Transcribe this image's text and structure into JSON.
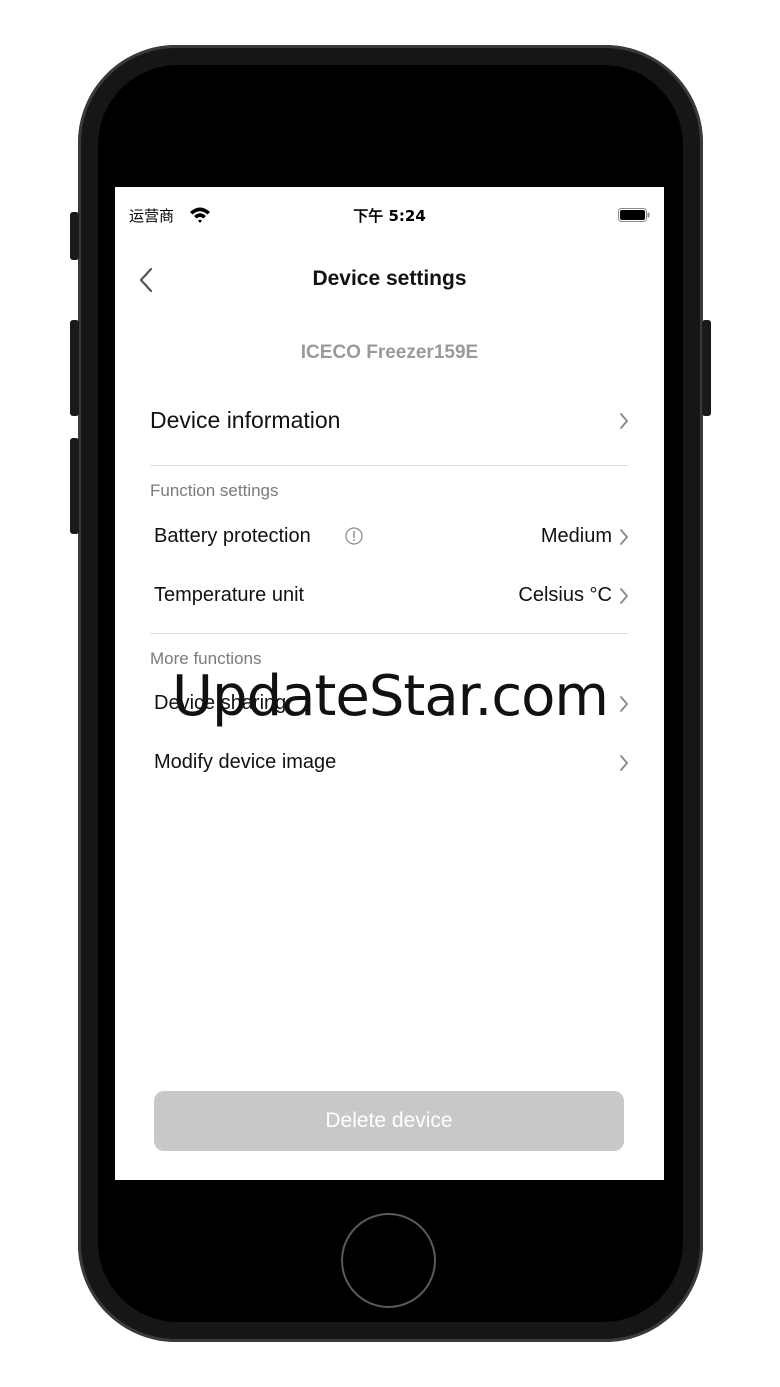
{
  "status_bar": {
    "carrier": "运营商",
    "time": "下午 5:24"
  },
  "header": {
    "title": "Device settings",
    "device_name": "ICECO Freezer159E"
  },
  "device_information": {
    "label": "Device information"
  },
  "function_settings": {
    "section_label": "Function settings",
    "battery_protection": {
      "label": "Battery protection",
      "value": "Medium"
    },
    "temperature_unit": {
      "label": "Temperature unit",
      "value": "Celsius °C"
    }
  },
  "more_functions": {
    "section_label": "More functions",
    "device_sharing": {
      "label": "Device sharing"
    },
    "modify_image": {
      "label": "Modify device image"
    }
  },
  "footer": {
    "delete_label": "Delete device"
  },
  "watermark": "UpdateStar.com",
  "colors": {
    "disabled_button": "#c8c8c8",
    "muted_text": "#9a9a9a",
    "section_text": "#7a7a7a",
    "divider": "#dddddd"
  },
  "icons": [
    "wifi-icon",
    "battery-icon",
    "back-chevron-icon",
    "info-icon",
    "chevron-right-icon"
  ]
}
